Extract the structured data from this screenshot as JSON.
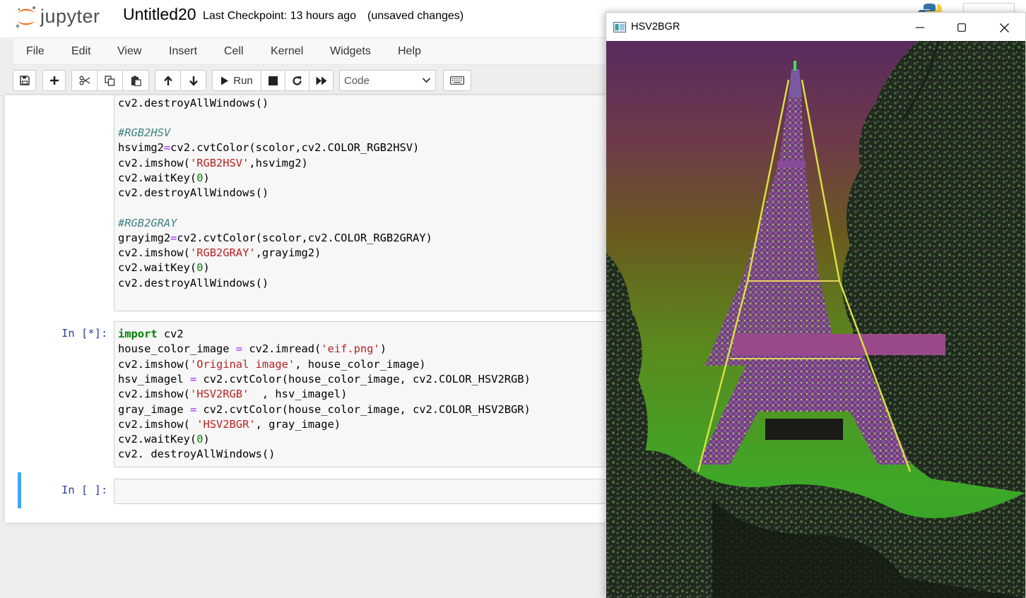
{
  "header": {
    "logo_text": "jupyter",
    "notebook_name": "Untitled20",
    "checkpoint": "Last Checkpoint: 13 hours ago",
    "unsaved": "(unsaved changes)"
  },
  "menubar": {
    "items": [
      "File",
      "Edit",
      "View",
      "Insert",
      "Cell",
      "Kernel",
      "Widgets",
      "Help"
    ]
  },
  "toolbar": {
    "run_label": "Run",
    "cell_type": "Code"
  },
  "cells": {
    "cell1_lines": [
      "cv2.destroyAllWindows()",
      "",
      "#RGB2HSV",
      "hsvimg2=cv2.cvtColor(scolor,cv2.COLOR_RGB2HSV)",
      "cv2.imshow('RGB2HSV',hsvimg2)",
      "cv2.waitKey(0)",
      "cv2.destroyAllWindows()",
      "",
      "#RGB2GRAY",
      "grayimg2=cv2.cvtColor(scolor,cv2.COLOR_RGB2GRAY)",
      "cv2.imshow('RGB2GRAY',grayimg2)",
      "cv2.waitKey(0)",
      "cv2.destroyAllWindows()"
    ],
    "cell2_prompt": "In [*]:",
    "cell2_lines": [
      "import cv2",
      "house_color_image = cv2.imread('eif.png')",
      "cv2.imshow('Original image', house_color_image)",
      "hsv_imagel = cv2.cvtColor(house_color_image, cv2.COLOR_HSV2RGB)",
      "cv2.imshow('HSV2RGB' , hsv_imagel)",
      "gray_image = cv2.cvtColor(house_color_image, cv2.COLOR_HSV2BGR)",
      "cv2.imshow( 'HSV2BGR', gray_image)",
      "cv2.waitKey(0)",
      "cv2. destroyAllWindows()"
    ],
    "cell3_prompt": "In [ ]:"
  },
  "cv_window": {
    "title": "HSV2BGR"
  },
  "colors": {
    "prompt": "#303f9f",
    "keyword": "#008000",
    "operator": "#aa22ff",
    "string": "#ba2121",
    "comment": "#408080",
    "selected_bar": "#42a5f5"
  }
}
